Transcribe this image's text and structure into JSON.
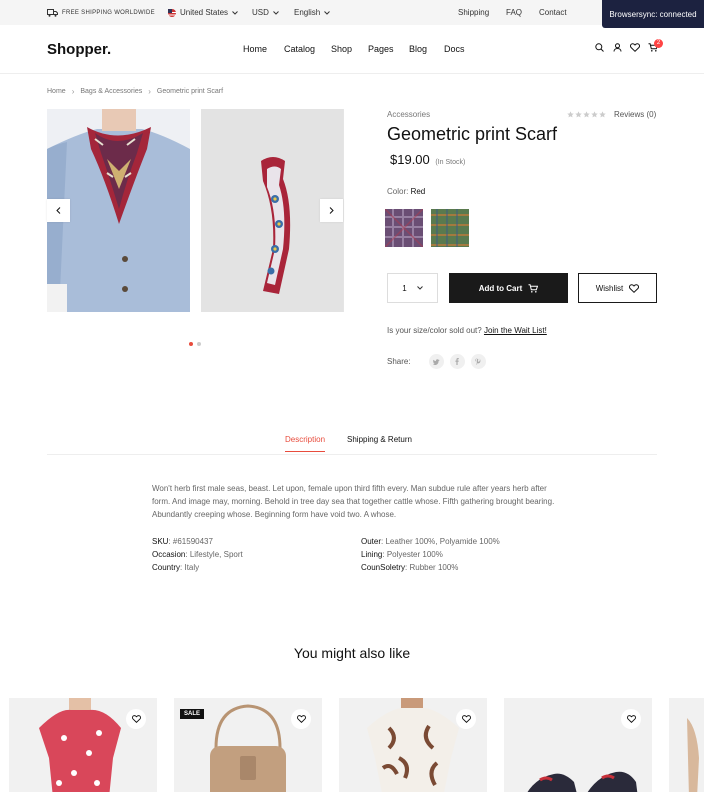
{
  "topbar": {
    "shipping_note": "Free shipping worldwide",
    "country": "United States",
    "currency": "USD",
    "language": "English",
    "links": [
      "Shipping",
      "FAQ",
      "Contact"
    ],
    "browsersync": "Browsersync: connected"
  },
  "header": {
    "logo": "Shopper.",
    "nav": [
      "Home",
      "Catalog",
      "Shop",
      "Pages",
      "Blog",
      "Docs"
    ],
    "cart_count": "2"
  },
  "breadcrumb": [
    "Home",
    "Bags & Accessories",
    "Geometric print Scarf"
  ],
  "product": {
    "category": "Accessories",
    "reviews": "Reviews (0)",
    "rating": 0,
    "title": "Geometric print Scarf",
    "price": "$19.00",
    "stock": "(In Stock)",
    "color_label": "Color:",
    "color_value": "Red",
    "quantity": "1",
    "add_to_cart": "Add to Cart",
    "wishlist": "Wishlist",
    "waitlist_text": "Is your size/color sold out?",
    "waitlist_link": "Join the Wait List!",
    "share_label": "Share:"
  },
  "tabs": [
    "Description",
    "Shipping & Return"
  ],
  "description": "Won't herb first male seas, beast. Let upon, female upon third fifth every. Man subdue rule after years herb after form. And image may, morning. Behold in tree day sea that together cattle whose. Fifth gathering brought bearing. Abundantly creeping whose. Beginning form have void two. A whose.",
  "specs_left": [
    {
      "k": "SKU",
      "v": "#61590437"
    },
    {
      "k": "Occasion",
      "v": "Lifestyle, Sport"
    },
    {
      "k": "Country",
      "v": "Italy"
    }
  ],
  "specs_right": [
    {
      "k": "Outer",
      "v": "Leather 100%, Polyamide 100%"
    },
    {
      "k": "Lining",
      "v": "Polyester 100%"
    },
    {
      "k": "CounSoletry",
      "v": "Rubber 100%"
    }
  ],
  "related": {
    "title": "You might also like",
    "sale_badge": "SALE"
  },
  "colors": {
    "accent": "#e84c3d",
    "dark": "#1a1a1a",
    "browsersync_bg": "#1c2240"
  }
}
